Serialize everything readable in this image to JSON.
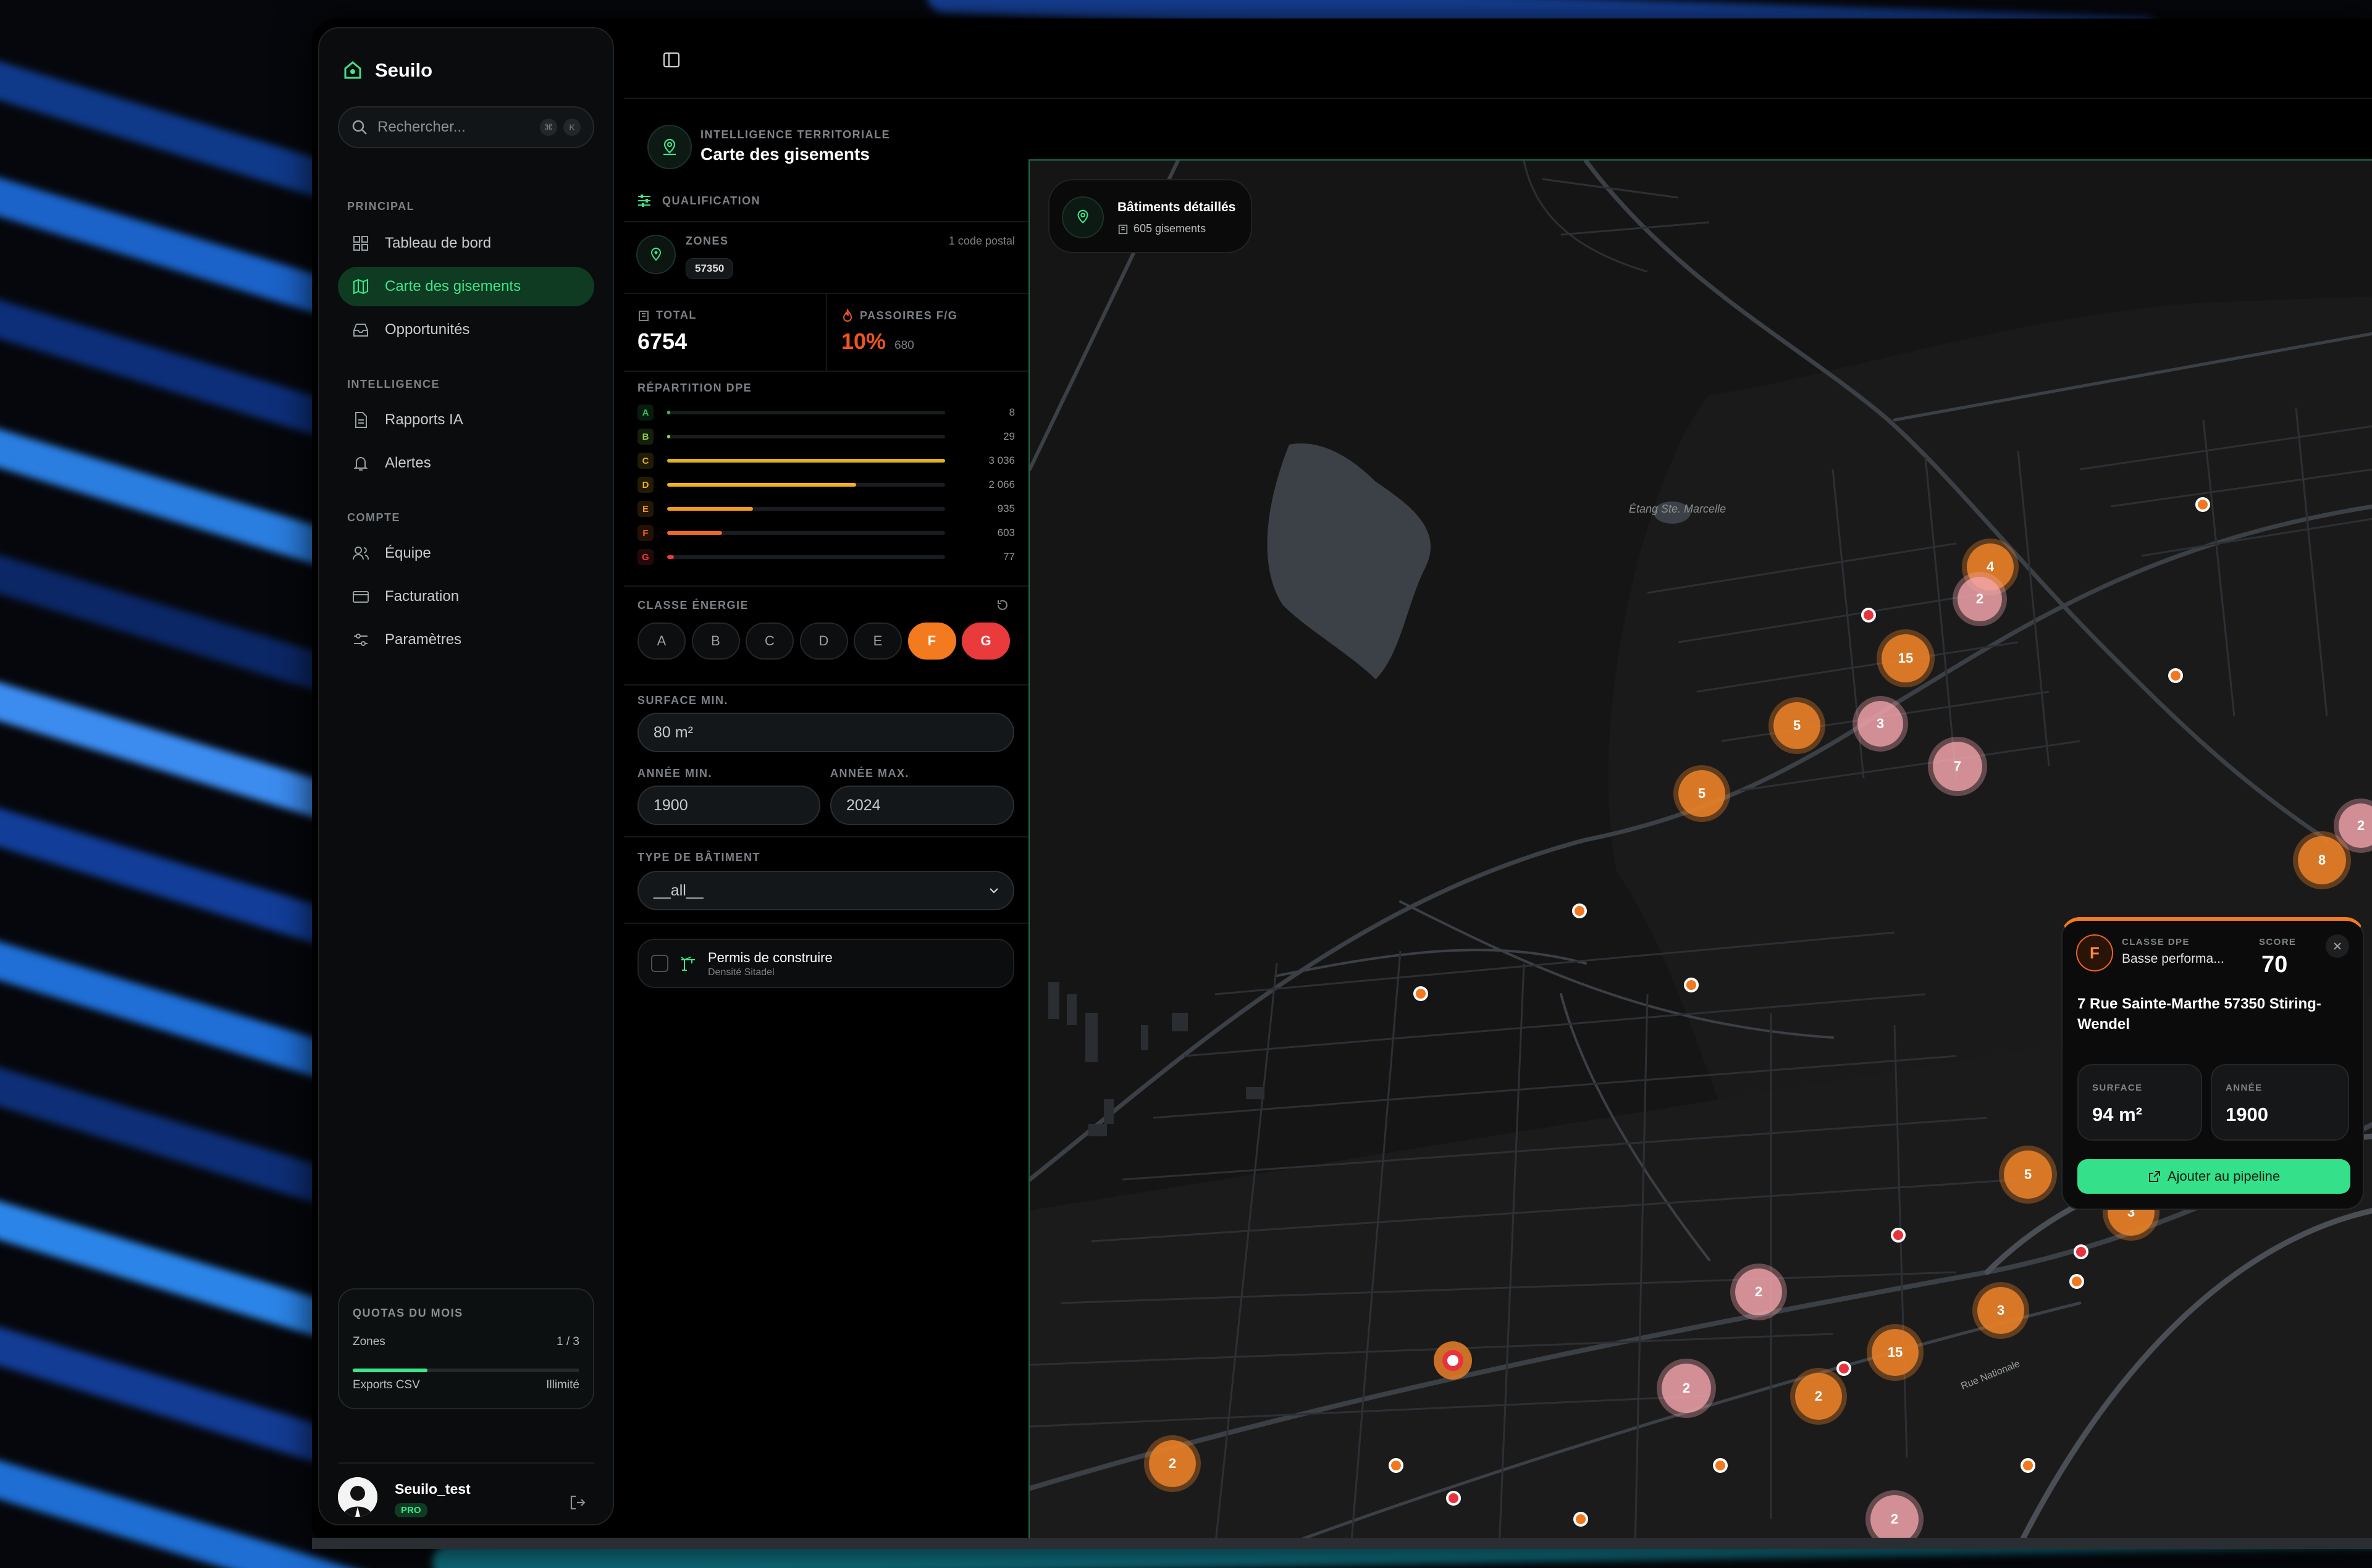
{
  "app": {
    "name": "Seuilo"
  },
  "search": {
    "placeholder": "Rechercher...",
    "kbd1": "⌘",
    "kbd2": "K"
  },
  "sidebar": {
    "section_principal": "PRINCIPAL",
    "section_intelligence": "INTELLIGENCE",
    "section_compte": "COMPTE",
    "items": [
      {
        "label": "Tableau de bord",
        "icon": "dashboard-icon"
      },
      {
        "label": "Carte des gisements",
        "icon": "map-icon",
        "active": true
      },
      {
        "label": "Opportunités",
        "icon": "inbox-icon"
      },
      {
        "label": "Rapports IA",
        "icon": "document-icon"
      },
      {
        "label": "Alertes",
        "icon": "bell-icon"
      },
      {
        "label": "Équipe",
        "icon": "users-icon"
      },
      {
        "label": "Facturation",
        "icon": "card-icon"
      },
      {
        "label": "Paramètres",
        "icon": "sliders-icon"
      }
    ]
  },
  "quota": {
    "title": "QUOTAS DU MOIS",
    "zones_label": "Zones",
    "zones_value": "1 / 3",
    "zones_progress": 0.33,
    "csv_label": "Exports CSV",
    "csv_value": "Illimité"
  },
  "user": {
    "name": "Seuilo_test",
    "badge": "PRO"
  },
  "header": {
    "eyebrow": "INTELLIGENCE TERRITORIALE",
    "title": "Carte des gisements"
  },
  "panel": {
    "qualification": "QUALIFICATION",
    "zones_label": "ZONES",
    "zones_meta": "1 code postal",
    "zone_chip": "57350",
    "total_label": "TOTAL",
    "total_value": "6754",
    "passoires_label": "PASSOIRES F/G",
    "passoires_pct": "10%",
    "passoires_count": "680",
    "repartition_label": "RÉPARTITION DPE",
    "dpe": [
      {
        "cls": "A",
        "count": "8",
        "value": 8,
        "color": "#2fbf5b"
      },
      {
        "cls": "B",
        "count": "29",
        "value": 29,
        "color": "#8bd14a"
      },
      {
        "cls": "C",
        "count": "3 036",
        "value": 3036,
        "color": "#e0b21c"
      },
      {
        "cls": "D",
        "count": "2 066",
        "value": 2066,
        "color": "#f0b418"
      },
      {
        "cls": "E",
        "count": "935",
        "value": 935,
        "color": "#f39a1f"
      },
      {
        "cls": "F",
        "count": "603",
        "value": 603,
        "color": "#f06a1f"
      },
      {
        "cls": "G",
        "count": "77",
        "value": 77,
        "color": "#e93b3b"
      }
    ],
    "classe_label": "CLASSE ÉNERGIE",
    "classes": [
      "A",
      "B",
      "C",
      "D",
      "E",
      "F",
      "G"
    ],
    "surface_label": "SURFACE MIN.",
    "surface_value": "80 m²",
    "annee_min_label": "ANNÉE MIN.",
    "annee_min_value": "1900",
    "annee_max_label": "ANNÉE MAX.",
    "annee_max_value": "2024",
    "type_label": "TYPE DE BÂTIMENT",
    "type_value": "__all__",
    "permis_title": "Permis de construire",
    "permis_sub": "Densité Sitadel"
  },
  "map": {
    "badge_title": "Bâtiments détaillés",
    "badge_sub": "605 gisements",
    "place_label": "Étang Ste. Marcelle",
    "street_label": "Rue Nationale"
  },
  "popup": {
    "dpe_letter": "F",
    "classe_label": "CLASSE DPE",
    "classe_value": "Basse performa...",
    "score_label": "SCORE",
    "score_value": "70",
    "address": "7 Rue Sainte-Marthe 57350 Stiring-Wendel",
    "surface_label": "SURFACE",
    "surface_value": "94 m²",
    "annee_label": "ANNÉE",
    "annee_value": "1900",
    "cta": "Ajouter au pipeline"
  },
  "clusters": [
    {
      "count": "4",
      "kind": "orange"
    },
    {
      "count": "2",
      "kind": "pink"
    },
    {
      "count": "15",
      "kind": "orange"
    },
    {
      "count": "3",
      "kind": "pink"
    },
    {
      "count": "5",
      "kind": "orange"
    },
    {
      "count": "7",
      "kind": "pink"
    },
    {
      "count": "5",
      "kind": "orange"
    },
    {
      "count": "8",
      "kind": "orange"
    },
    {
      "count": "2",
      "kind": "pink"
    },
    {
      "count": "5",
      "kind": "orange"
    },
    {
      "count": "3",
      "kind": "orange"
    },
    {
      "count": "2",
      "kind": "pink"
    },
    {
      "count": "3",
      "kind": "orange"
    },
    {
      "count": "15",
      "kind": "orange"
    },
    {
      "count": "2",
      "kind": "pink"
    },
    {
      "count": "2",
      "kind": "orange"
    },
    {
      "count": "2",
      "kind": "orange"
    },
    {
      "count": "2",
      "kind": "pink"
    }
  ]
}
